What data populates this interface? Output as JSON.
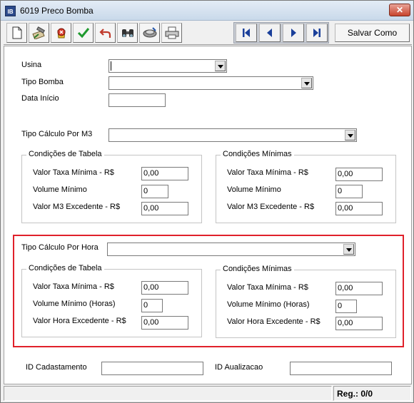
{
  "window": {
    "icon_text": "IB",
    "title": "6019 Preco Bomba",
    "close_glyph": "✕"
  },
  "toolbar": {
    "icons": [
      "new-document-icon",
      "edit-icon",
      "delete-icon",
      "confirm-icon",
      "undo-icon",
      "search-binoculars-icon",
      "clear-icon",
      "print-icon"
    ],
    "nav_icons": [
      "first-record-icon",
      "previous-record-icon",
      "next-record-icon",
      "last-record-icon"
    ],
    "save_label": "Salvar Como"
  },
  "form": {
    "usina_label": "Usina",
    "usina_value": "",
    "tipo_bomba_label": "Tipo Bomba",
    "tipo_bomba_value": "",
    "data_inicio_label": "Data Início",
    "data_inicio_value": "",
    "tipo_calculo_m3_label": "Tipo Cálculo Por M3",
    "tipo_calculo_m3_value": ""
  },
  "m3_tabela": {
    "title": "Condições de Tabela",
    "taxa_label": "Valor Taxa Mínima - R$",
    "taxa_value": "0,00",
    "volume_label": "Volume Mínimo",
    "volume_value": "0",
    "excedente_label": "Valor M3 Excedente - R$",
    "excedente_value": "0,00"
  },
  "m3_minimas": {
    "title": "Condições Mínimas",
    "taxa_label": "Valor Taxa Mínima - R$",
    "taxa_value": "0,00",
    "volume_label": "Volume Mínimo",
    "volume_value": "0",
    "excedente_label": "Valor M3 Excedente - R$",
    "excedente_value": "0,00"
  },
  "hora": {
    "tipo_label": "Tipo Cálculo Por Hora",
    "tipo_value": "",
    "highlight_color": "#e0212a"
  },
  "hora_tabela": {
    "title": "Condições de Tabela",
    "taxa_label": "Valor Taxa Mínima - R$",
    "taxa_value": "0,00",
    "volume_label": "Volume Mínimo (Horas)",
    "volume_value": "0",
    "excedente_label": "Valor Hora Excedente - R$",
    "excedente_value": "0,00"
  },
  "hora_minimas": {
    "title": "Condições Mínimas",
    "taxa_label": "Valor Taxa Mínima - R$",
    "taxa_value": "0,00",
    "volume_label": "Volume Mínimo (Horas)",
    "volume_value": "0",
    "excedente_label": "Valor Hora Excedente - R$",
    "excedente_value": "0,00"
  },
  "footer": {
    "id_cadastramento_label": "ID Cadastamento",
    "id_cadastramento_value": "",
    "id_atualizacao_label": "ID Aualizacao",
    "id_atualizacao_value": ""
  },
  "status": {
    "left_text": "",
    "reg_text": "Reg.: 0/0"
  }
}
